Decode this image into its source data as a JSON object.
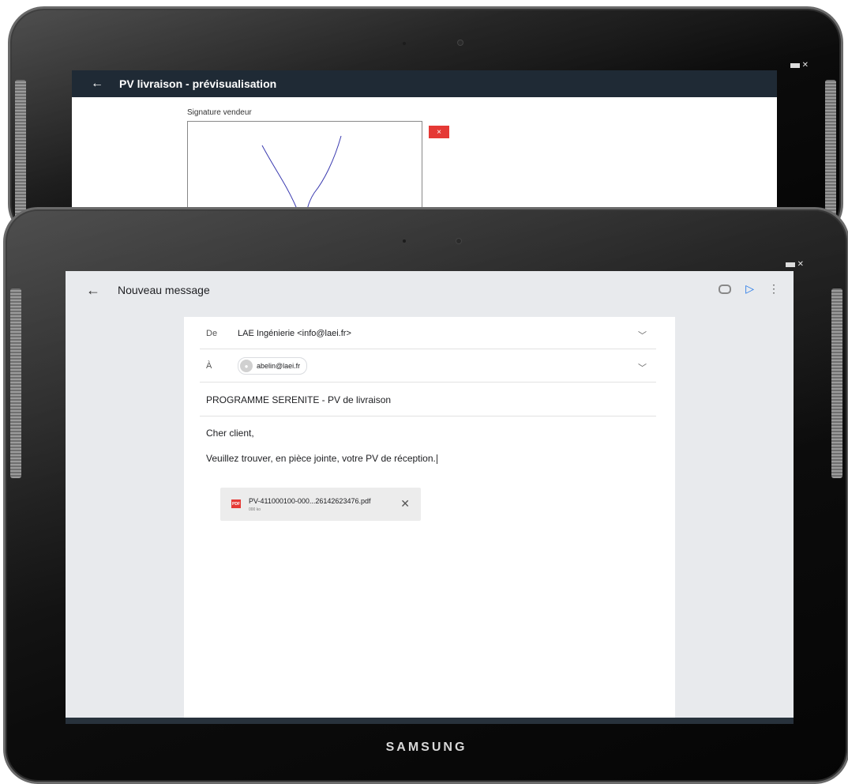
{
  "back_tablet": {
    "app_bar": {
      "back_icon": "arrow-left-icon",
      "title": "PV livraison - prévisualisation"
    },
    "signature": {
      "label": "Signature vendeur",
      "clear_button_label": "×"
    }
  },
  "front_tablet": {
    "app_bar": {
      "back_icon": "arrow-left-icon",
      "title": "Nouveau message",
      "actions": [
        "attach-icon",
        "send-icon",
        "more-vert-icon"
      ]
    },
    "compose": {
      "from_label": "De",
      "from_value": "LAE Ingénierie <info@laei.fr>",
      "to_label": "À",
      "to_chip": "abelin@laei.fr",
      "subject": "PROGRAMME SERENITE - PV de livraison",
      "greeting": "Cher client,",
      "body": "Veuillez trouver, en pièce jointe, votre PV de réception."
    },
    "attachment": {
      "name": "PV-411000100-000...26142623476.pdf",
      "size": "000 ko",
      "icon_label": "PDF"
    },
    "brand": "SAMSUNG"
  },
  "colors": {
    "app_bar_dark": "#1f2a35",
    "accent_send": "#1a73e8",
    "signature_ink": "#3b3bb0",
    "danger": "#e53935"
  }
}
